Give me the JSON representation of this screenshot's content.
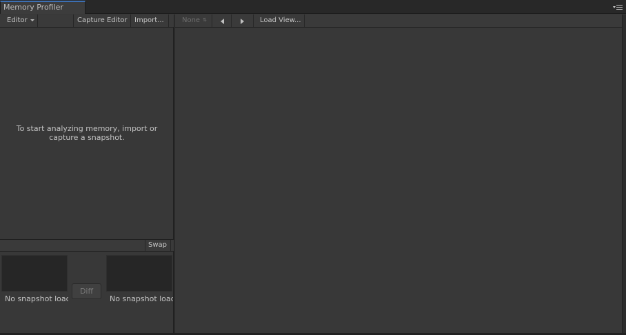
{
  "window": {
    "tab_title": "Memory Profiler"
  },
  "toolbar": {
    "target_label": "Editor",
    "capture_label": "Capture Editor",
    "import_label": "Import...",
    "view_select_label": "None",
    "load_view_label": "Load View..."
  },
  "left_panel": {
    "empty_message_line1": "To start analyzing memory, import or",
    "empty_message_line2": "capture a snapshot.",
    "swap_label": "Swap",
    "diff_label": "Diff",
    "slot_a_label": "No snapshot loaded",
    "slot_b_label": "No snapshot loaded"
  },
  "icons": {
    "tab_menu": "menu-lines-icon",
    "target_dropdown": "chevron-down-icon",
    "view_updown": "updown-arrows-icon",
    "back": "arrow-left-icon",
    "forward": "arrow-right-icon"
  },
  "colors": {
    "panel_bg": "#383838",
    "tab_accent": "#3c6fb3",
    "text": "#c4c4c4",
    "disabled_text": "#6e6e6e",
    "thumb_bg": "#262626"
  }
}
